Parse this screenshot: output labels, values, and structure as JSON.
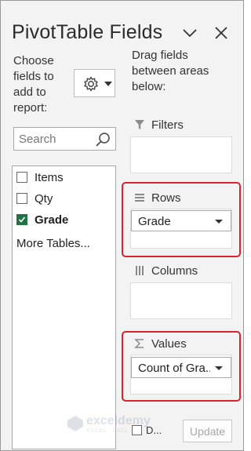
{
  "header": {
    "title": "PivotTable Fields"
  },
  "left": {
    "choose_text": [
      "Choose",
      "fields to",
      "add to",
      "report:"
    ],
    "search_placeholder": "Search",
    "fields": [
      {
        "label": "Items",
        "checked": false
      },
      {
        "label": "Qty",
        "checked": false
      },
      {
        "label": "Grade",
        "checked": true
      }
    ],
    "more_tables": "More Tables..."
  },
  "right": {
    "drag_text": [
      "Drag fields",
      "between areas",
      "below:"
    ],
    "filters": {
      "label": "Filters"
    },
    "rows": {
      "label": "Rows",
      "item": "Grade"
    },
    "columns": {
      "label": "Columns"
    },
    "values": {
      "label": "Values",
      "item": "Count of Gra..."
    }
  },
  "footer": {
    "defer_label": "D...",
    "update_label": "Update"
  },
  "watermark": {
    "name": "exceldemy",
    "tagline": "EXCEL · DATA · BI"
  },
  "colors": {
    "accent_green": "#217346",
    "highlight_red": "#d9232f"
  },
  "icons": [
    "chevron-down-icon",
    "close-icon",
    "gear-icon",
    "search-icon",
    "filter-icon",
    "rows-icon",
    "columns-icon",
    "sigma-icon"
  ]
}
